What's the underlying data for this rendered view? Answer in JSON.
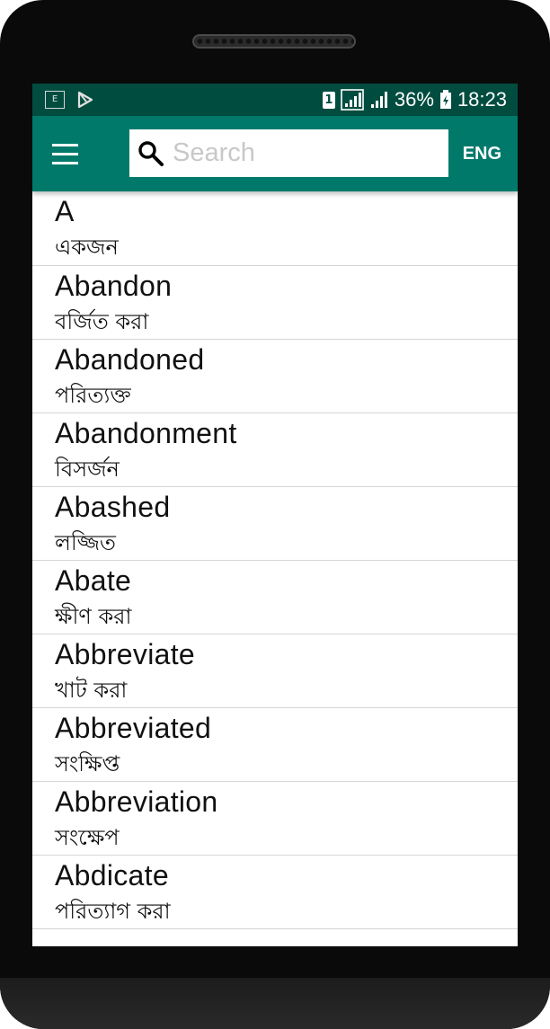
{
  "status_bar": {
    "sim_number": "1",
    "battery": "36%",
    "time": "18:23",
    "left_icons": [
      "dictionary-app-icon",
      "play-store-icon"
    ]
  },
  "app_bar": {
    "menu_icon": "hamburger-menu-icon",
    "search_icon": "search-icon",
    "search_placeholder": "Search",
    "search_value": "",
    "language_label": "ENG",
    "accent_color": "#00796b",
    "status_color": "#004d40"
  },
  "words": [
    {
      "en": "A",
      "bn": "একজন"
    },
    {
      "en": "Abandon",
      "bn": "বর্জিত করা"
    },
    {
      "en": "Abandoned",
      "bn": "পরিত্যক্ত"
    },
    {
      "en": "Abandonment",
      "bn": "বিসর্জন"
    },
    {
      "en": "Abashed",
      "bn": "লজ্জিত"
    },
    {
      "en": "Abate",
      "bn": "ক্ষীণ করা"
    },
    {
      "en": "Abbreviate",
      "bn": "খাট করা"
    },
    {
      "en": "Abbreviated",
      "bn": "সংক্ষিপ্ত"
    },
    {
      "en": "Abbreviation",
      "bn": "সংক্ষেপ"
    },
    {
      "en": "Abdicate",
      "bn": "পরিত্যাগ করা"
    }
  ]
}
